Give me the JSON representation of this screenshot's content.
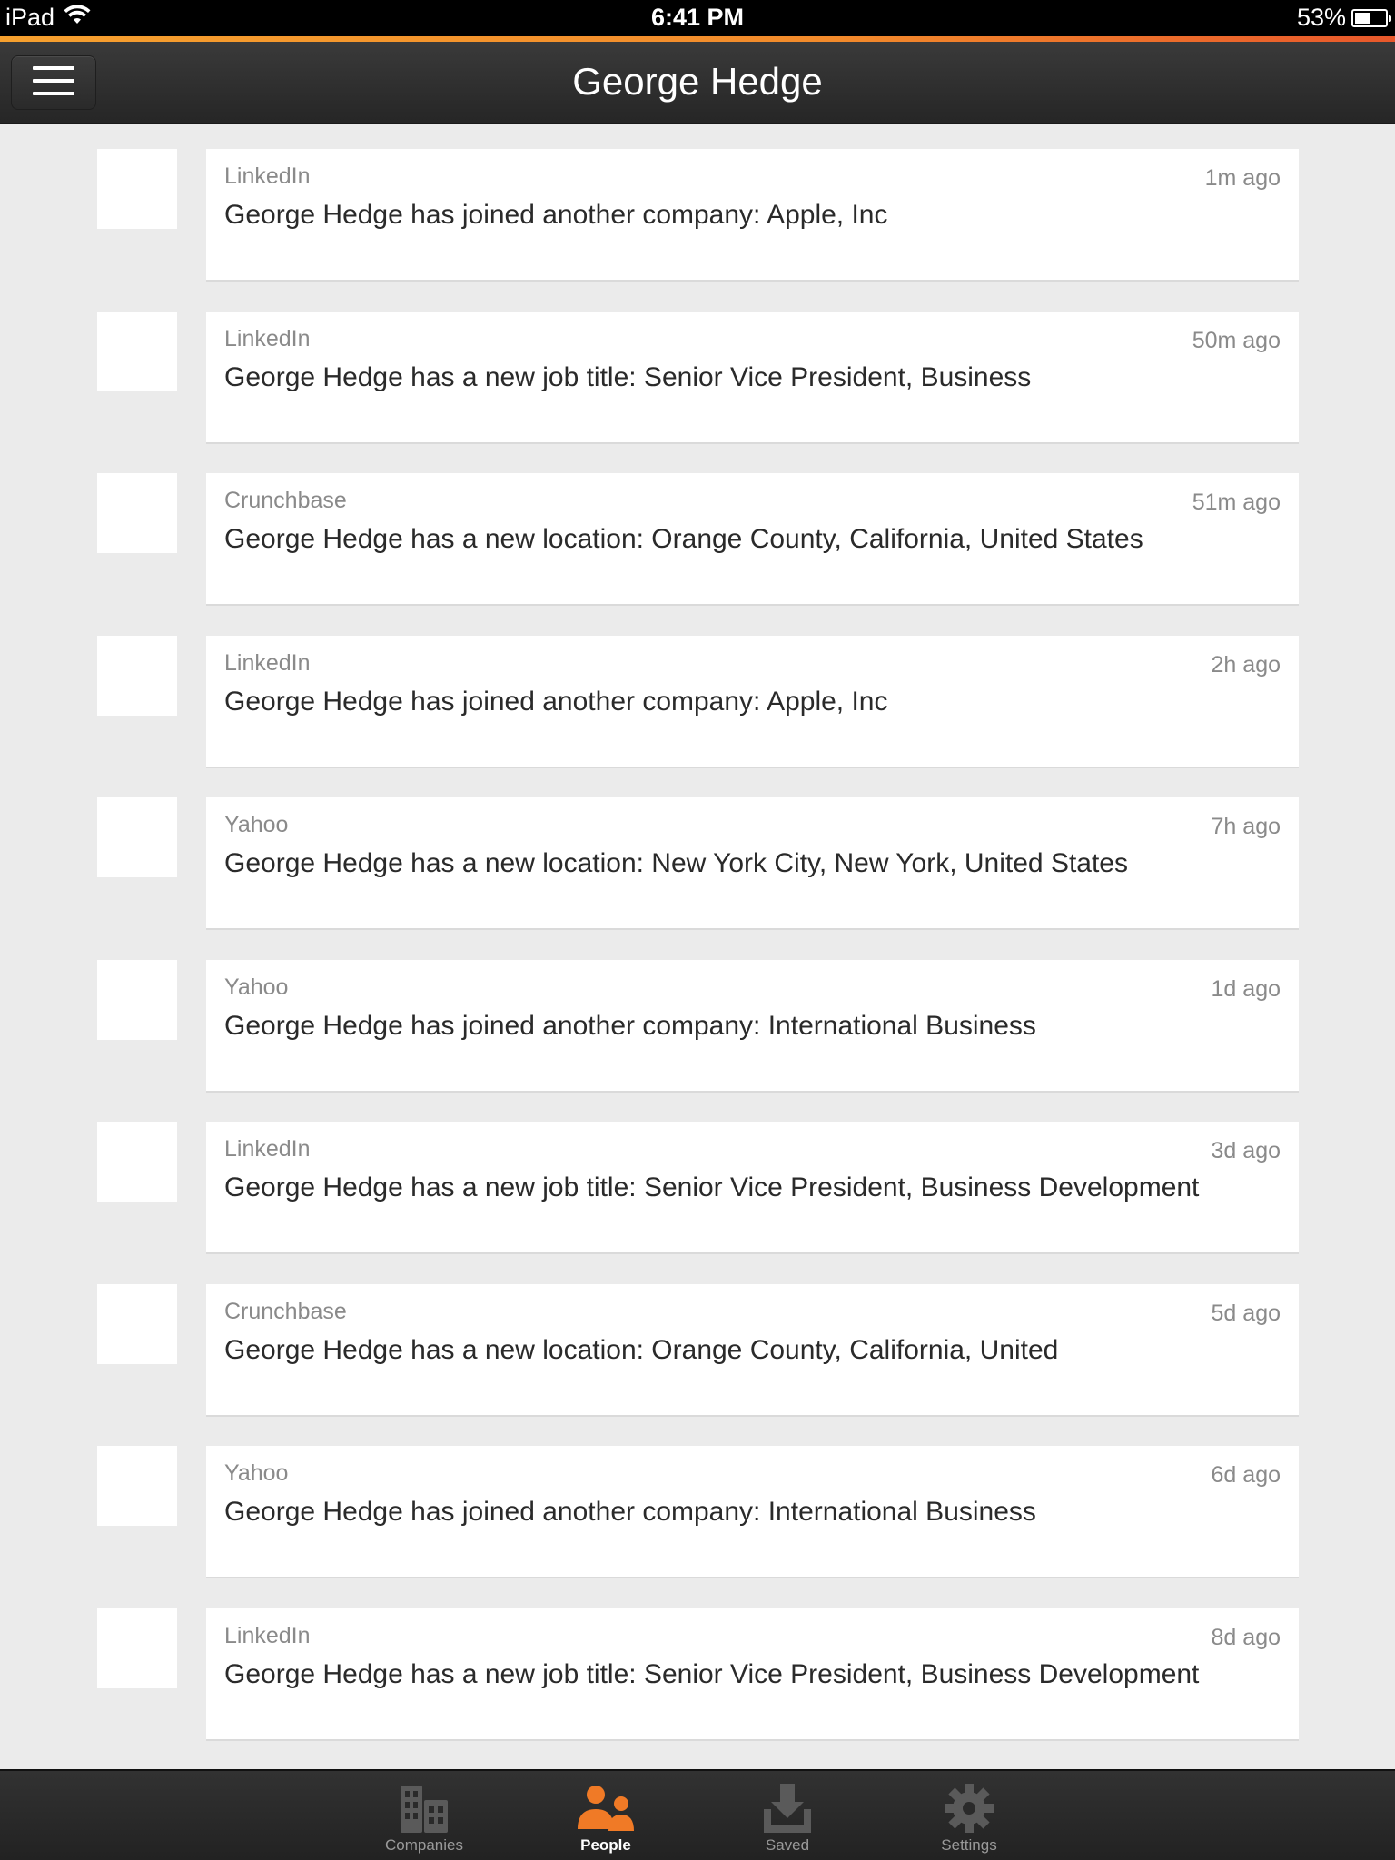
{
  "status_bar": {
    "device": "iPad",
    "time": "6:41 PM",
    "battery": "53%",
    "battery_level": 0.53
  },
  "header": {
    "title": "George Hedge",
    "menu_icon": "hamburger-menu-icon"
  },
  "feed": {
    "items": [
      {
        "source": "LinkedIn",
        "time": "1m ago",
        "message": "George Hedge has joined another company: Apple, Inc"
      },
      {
        "source": "LinkedIn",
        "time": "50m ago",
        "message": "George Hedge has a new job title: Senior Vice President, Business"
      },
      {
        "source": "Crunchbase",
        "time": "51m ago",
        "message": "George Hedge has a new location: Orange County, California, United States"
      },
      {
        "source": "LinkedIn",
        "time": "2h ago",
        "message": "George Hedge has joined another company: Apple, Inc"
      },
      {
        "source": "Yahoo",
        "time": "7h ago",
        "message": "George Hedge has a new location: New York City, New York, United States"
      },
      {
        "source": "Yahoo",
        "time": "1d ago",
        "message": "George Hedge has joined another company: International Business"
      },
      {
        "source": "LinkedIn",
        "time": "3d ago",
        "message": "George Hedge has a new job title: Senior Vice President, Business Development"
      },
      {
        "source": "Crunchbase",
        "time": "5d ago",
        "message": "George Hedge has a new location: Orange County, California, United"
      },
      {
        "source": "Yahoo",
        "time": "6d ago",
        "message": "George Hedge has joined another company: International Business"
      },
      {
        "source": "LinkedIn",
        "time": "8d ago",
        "message": "George Hedge has a new job title: Senior Vice President, Business Development"
      }
    ]
  },
  "tab_bar": {
    "tabs": [
      {
        "label": "Companies",
        "icon": "buildings-icon",
        "active": false
      },
      {
        "label": "People",
        "icon": "people-icon",
        "active": true
      },
      {
        "label": "Saved",
        "icon": "download-tray-icon",
        "active": false
      },
      {
        "label": "Settings",
        "icon": "gear-icon",
        "active": false
      }
    ]
  },
  "colors": {
    "accent": "#f28a2b",
    "active_tab_icon": "#f07a26",
    "inactive_tab_icon": "#5a5a5a"
  }
}
